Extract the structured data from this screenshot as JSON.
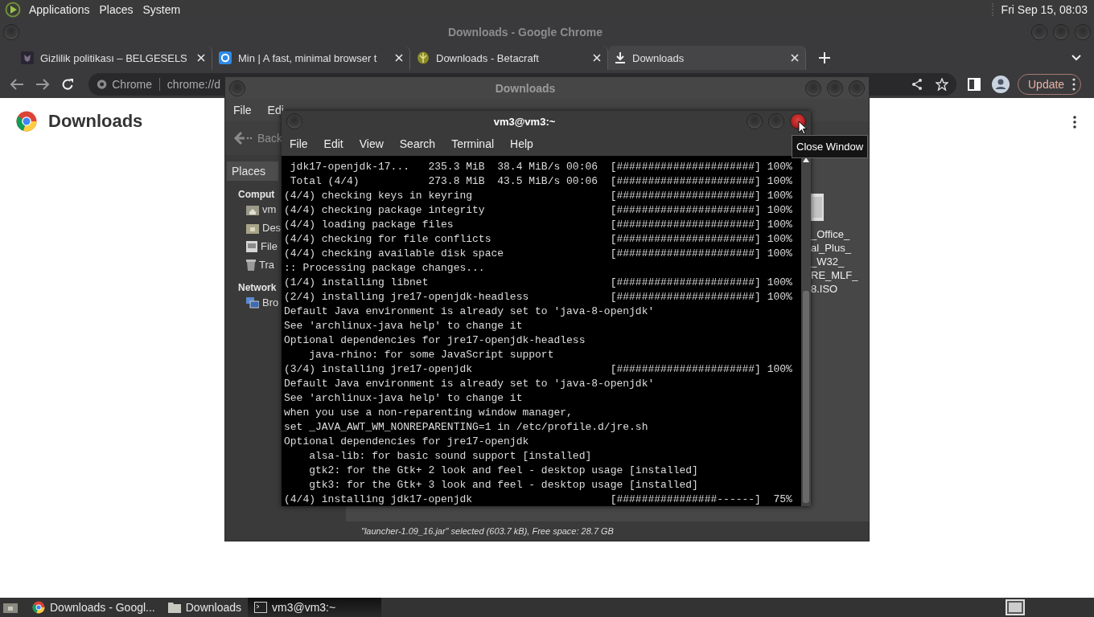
{
  "top_panel": {
    "menus": [
      "Applications",
      "Places",
      "System"
    ],
    "clock": "Fri Sep 15, 08:03"
  },
  "browser": {
    "title": "Downloads - Google Chrome",
    "tabs": [
      {
        "title": "Gizlilik politikası – BELGESELS",
        "selected": false
      },
      {
        "title": "Min | A fast, minimal browser t",
        "selected": false
      },
      {
        "title": "Downloads - Betacraft",
        "selected": false
      },
      {
        "title": "Downloads",
        "selected": true
      }
    ],
    "omnibox": {
      "label": "Chrome",
      "url": "chrome://d"
    },
    "update_button": "Update",
    "page_title": "Downloads"
  },
  "file_manager": {
    "title": "Downloads",
    "menus": [
      "File",
      "Edi"
    ],
    "back": "Back",
    "sidebar": {
      "header": "Places",
      "sections": [
        {
          "label": "Comput",
          "children": [
            "vm",
            "Des",
            "File",
            "Tra"
          ]
        },
        {
          "label": "Network",
          "children": [
            "Bro"
          ]
        }
      ]
    },
    "file_name_lines": [
      "_Office_",
      "al_Plus_",
      "_W32_",
      "RE_MLF_",
      "8.ISO"
    ],
    "status": "\"launcher-1.09_16.jar\" selected (603.7 kB), Free space: 28.7 GB"
  },
  "terminal": {
    "title": "vm3@vm3:~",
    "menus": [
      "File",
      "Edit",
      "View",
      "Search",
      "Terminal",
      "Help"
    ],
    "lines": [
      {
        "text": " jdk17-openjdk-17...   235.3 MiB  38.4 MiB/s 00:06",
        "progress": "[######################] 100%"
      },
      {
        "text": " Total (4/4)           273.8 MiB  43.5 MiB/s 00:06",
        "progress": "[######################] 100%"
      },
      {
        "text": "(4/4) checking keys in keyring",
        "progress": "[######################] 100%"
      },
      {
        "text": "(4/4) checking package integrity",
        "progress": "[######################] 100%"
      },
      {
        "text": "(4/4) loading package files",
        "progress": "[######################] 100%"
      },
      {
        "text": "(4/4) checking for file conflicts",
        "progress": "[######################] 100%"
      },
      {
        "text": "(4/4) checking available disk space",
        "progress": "[######################] 100%"
      },
      {
        "text": ":: Processing package changes..."
      },
      {
        "text": "(1/4) installing libnet",
        "progress": "[######################] 100%"
      },
      {
        "text": "(2/4) installing jre17-openjdk-headless",
        "progress": "[######################] 100%"
      },
      {
        "text": "Default Java environment is already set to 'java-8-openjdk'"
      },
      {
        "text": "See 'archlinux-java help' to change it"
      },
      {
        "text": "Optional dependencies for jre17-openjdk-headless"
      },
      {
        "text": "    java-rhino: for some JavaScript support"
      },
      {
        "text": "(3/4) installing jre17-openjdk",
        "progress": "[######################] 100%"
      },
      {
        "text": "Default Java environment is already set to 'java-8-openjdk'"
      },
      {
        "text": "See 'archlinux-java help' to change it"
      },
      {
        "text": "when you use a non-reparenting window manager,"
      },
      {
        "text": "set _JAVA_AWT_WM_NONREPARENTING=1 in /etc/profile.d/jre.sh"
      },
      {
        "text": "Optional dependencies for jre17-openjdk"
      },
      {
        "text": "    alsa-lib: for basic sound support [installed]"
      },
      {
        "text": "    gtk2: for the Gtk+ 2 look and feel - desktop usage [installed]"
      },
      {
        "text": "    gtk3: for the Gtk+ 3 look and feel - desktop usage [installed]"
      },
      {
        "text": "(4/4) installing jdk17-openjdk",
        "progress": "[################------]  75%"
      }
    ]
  },
  "tooltip": "Close Window",
  "taskbar": {
    "items": [
      {
        "label": "Downloads - Googl...",
        "selected": false
      },
      {
        "label": "Downloads",
        "selected": false
      },
      {
        "label": "vm3@vm3:~",
        "selected": true
      }
    ]
  }
}
